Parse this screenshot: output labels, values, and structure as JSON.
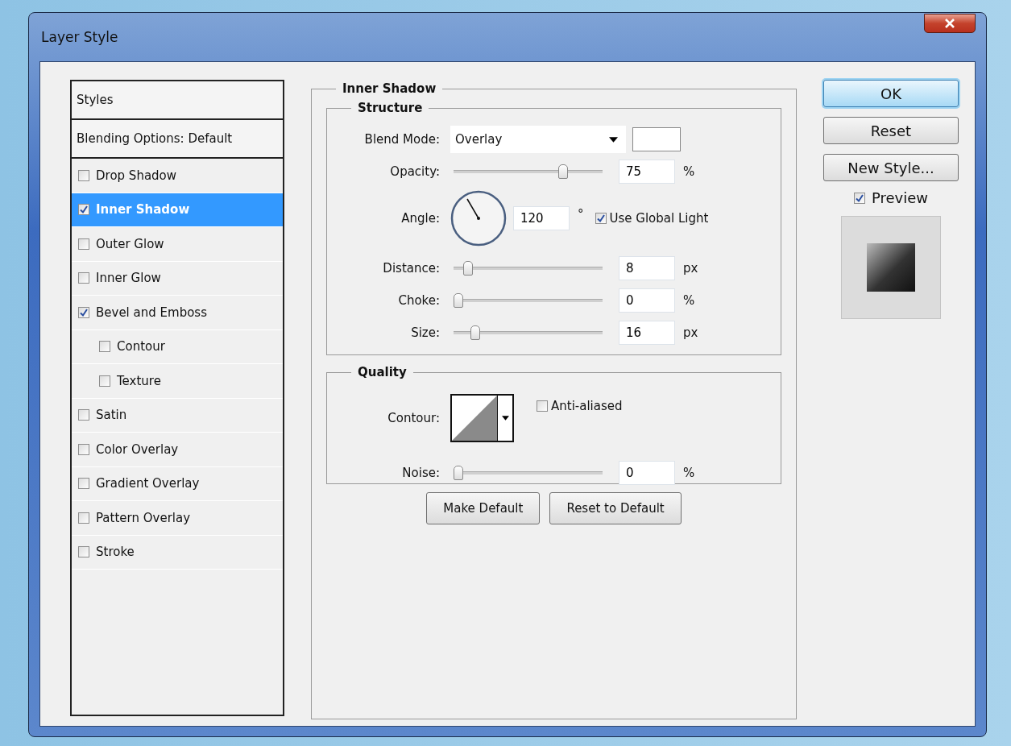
{
  "window": {
    "title": "Layer Style"
  },
  "styles_panel": {
    "header": "Styles",
    "blending_options": "Blending Options: Default",
    "effects": [
      {
        "label": "Drop Shadow",
        "checked": false,
        "selected": false
      },
      {
        "label": "Inner Shadow",
        "checked": true,
        "selected": true
      },
      {
        "label": "Outer Glow",
        "checked": false,
        "selected": false
      },
      {
        "label": "Inner Glow",
        "checked": false,
        "selected": false
      },
      {
        "label": "Bevel and Emboss",
        "checked": true,
        "selected": false,
        "children": [
          {
            "label": "Contour",
            "checked": false,
            "selected": false
          },
          {
            "label": "Texture",
            "checked": false,
            "selected": false
          }
        ]
      },
      {
        "label": "Satin",
        "checked": false,
        "selected": false
      },
      {
        "label": "Color Overlay",
        "checked": false,
        "selected": false
      },
      {
        "label": "Gradient Overlay",
        "checked": false,
        "selected": false
      },
      {
        "label": "Pattern Overlay",
        "checked": false,
        "selected": false
      },
      {
        "label": "Stroke",
        "checked": false,
        "selected": false
      }
    ]
  },
  "inner_shadow": {
    "title": "Inner Shadow",
    "structure": {
      "title": "Structure",
      "rows": [
        {
          "kind": "dropdown",
          "label": "Blend Mode:",
          "value": "Overlay"
        },
        {
          "kind": "slider",
          "label": "Opacity:",
          "level": 0.75,
          "value": "75",
          "unit": "%"
        },
        {
          "kind": "angle",
          "label": "Angle:",
          "value": "120",
          "unit": "°",
          "global_light": {
            "label": "Use Global Light",
            "checked": true
          }
        },
        {
          "kind": "slider",
          "label": "Distance:",
          "level": 0.07,
          "value": "8",
          "unit": "px"
        },
        {
          "kind": "slider",
          "label": "Choke:",
          "level": 0,
          "value": "0",
          "unit": "%"
        },
        {
          "kind": "slider",
          "label": "Size:",
          "level": 0.12,
          "value": "16",
          "unit": "px"
        }
      ]
    },
    "quality": {
      "title": "Quality",
      "contour_label": "Contour:",
      "anti_aliased": {
        "label": "Anti-aliased",
        "checked": false
      },
      "noise": {
        "label": "Noise:",
        "level": 0,
        "value": "0",
        "unit": "%"
      }
    },
    "buttons": [
      "Make Default",
      "Reset to Default"
    ]
  },
  "actions": [
    {
      "label": "OK",
      "default": true
    },
    {
      "label": "Reset",
      "default": false
    },
    {
      "label": "New Style...",
      "default": false
    }
  ],
  "preview": {
    "label": "Preview",
    "checked": true
  }
}
